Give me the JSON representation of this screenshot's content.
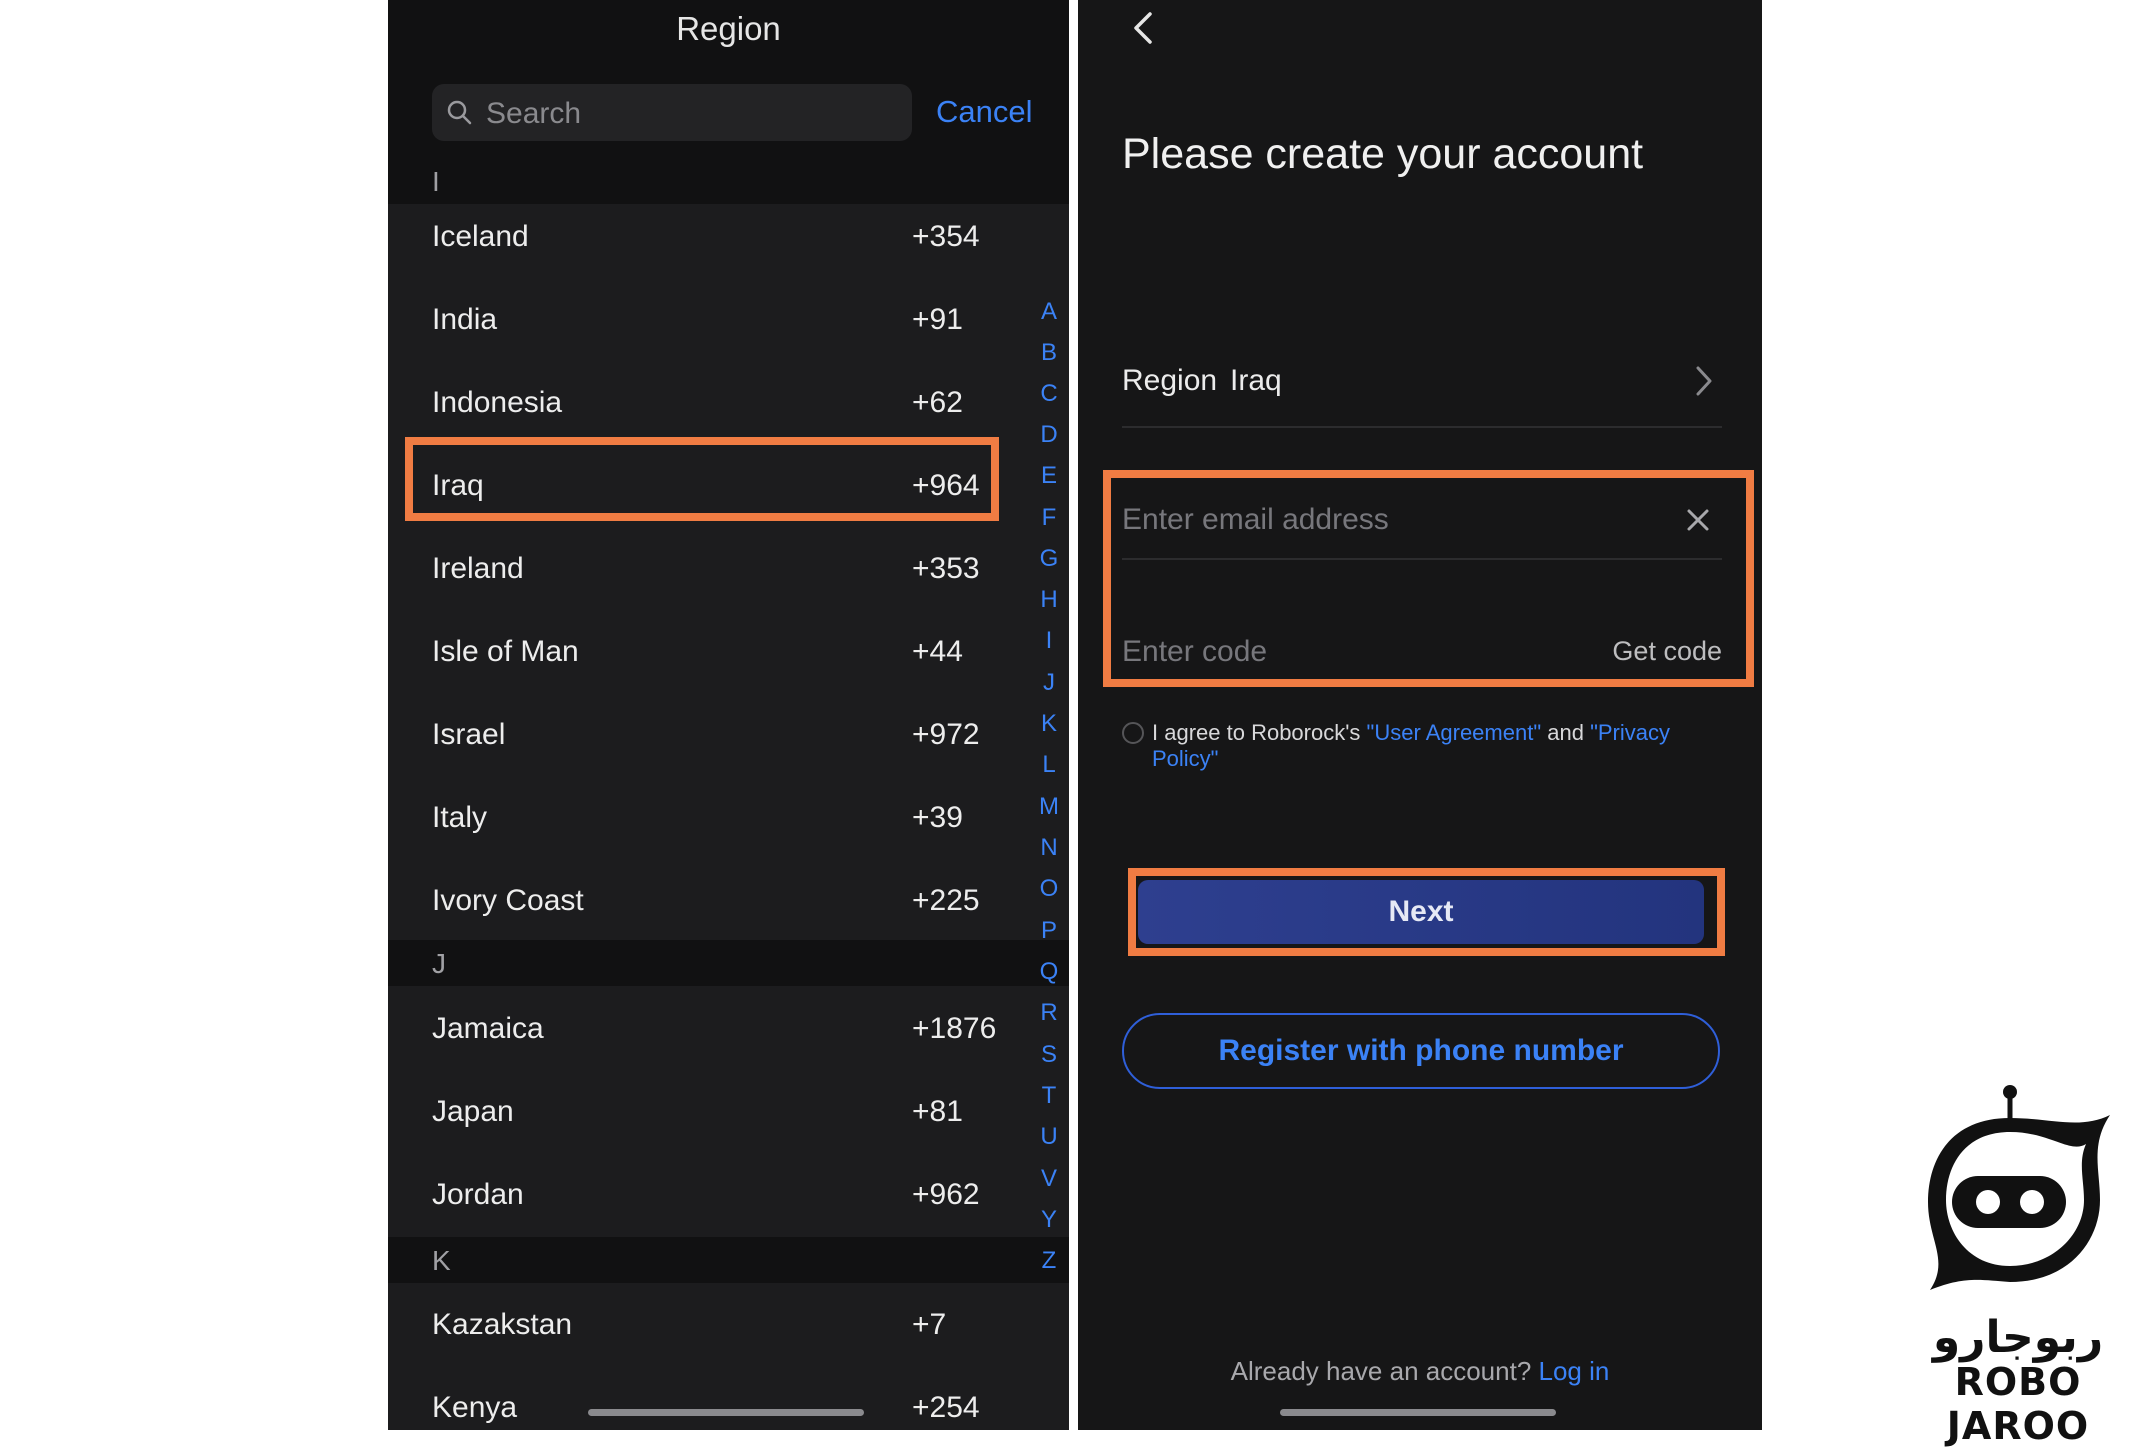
{
  "left_screen": {
    "title": "Region",
    "search": {
      "placeholder": "Search",
      "value": ""
    },
    "cancel_label": "Cancel",
    "sections": [
      {
        "letter": "I",
        "items": [
          {
            "name": "Iceland",
            "code": "+354"
          },
          {
            "name": "India",
            "code": "+91"
          },
          {
            "name": "Indonesia",
            "code": "+62"
          },
          {
            "name": "Iraq",
            "code": "+964"
          },
          {
            "name": "Ireland",
            "code": "+353"
          },
          {
            "name": "Isle of Man",
            "code": "+44"
          },
          {
            "name": "Israel",
            "code": "+972"
          },
          {
            "name": "Italy",
            "code": "+39"
          },
          {
            "name": "Ivory Coast",
            "code": "+225"
          }
        ]
      },
      {
        "letter": "J",
        "items": [
          {
            "name": "Jamaica",
            "code": "+1876"
          },
          {
            "name": "Japan",
            "code": "+81"
          },
          {
            "name": "Jordan",
            "code": "+962"
          }
        ]
      },
      {
        "letter": "K",
        "items": [
          {
            "name": "Kazakstan",
            "code": "+7"
          },
          {
            "name": "Kenya",
            "code": "+254"
          }
        ]
      }
    ],
    "alphabet_index": [
      "A",
      "B",
      "C",
      "D",
      "E",
      "F",
      "G",
      "H",
      "I",
      "J",
      "K",
      "L",
      "M",
      "N",
      "O",
      "P",
      "Q",
      "R",
      "S",
      "T",
      "U",
      "V",
      "Y",
      "Z"
    ],
    "highlighted_item": "Iraq"
  },
  "right_screen": {
    "heading": "Please create your account",
    "region_label": "Region",
    "region_value": "Iraq",
    "email_placeholder": "Enter email address",
    "code_placeholder": "Enter code",
    "get_code_label": "Get code",
    "agreement": {
      "prefix": "I agree to Roborock's ",
      "user_agreement": "\"User Agreement\"",
      "and": " and ",
      "privacy_line1": "\"Privacy",
      "privacy_line2": "Policy\""
    },
    "next_label": "Next",
    "register_phone_label": "Register with phone number",
    "already_prompt": "Already have an account?",
    "login_label": "Log in"
  },
  "branding": {
    "persian_text": "ربوجارو",
    "english_text": "ROBO JAROO"
  },
  "colors": {
    "accent_blue": "#3b82f6",
    "highlight_orange": "#f07c43",
    "screen_background": "#1c1c1e",
    "next_button": "#2e3f8f"
  }
}
